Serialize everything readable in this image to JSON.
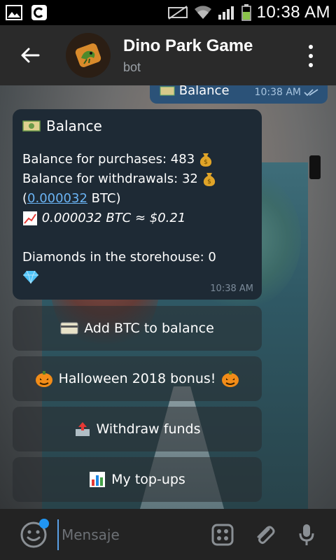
{
  "status_bar": {
    "time": "10:38 AM",
    "icons": [
      "image-icon",
      "c-app-icon",
      "nfc-muted-icon",
      "wifi-icon",
      "signal-icon",
      "battery-icon"
    ]
  },
  "header": {
    "title": "Dino Park Game",
    "subtitle": "bot"
  },
  "outgoing_message": {
    "text": "Balance",
    "time": "10:38 AM",
    "status": "read"
  },
  "incoming_message": {
    "title": "Balance",
    "purchases_label": "Balance for purchases:",
    "purchases_value": "483",
    "withdrawals_label": "Balance for withdrawals:",
    "withdrawals_value": "32",
    "btc_open": "(",
    "btc_link": "0.000032",
    "btc_close": " BTC)",
    "rate_text": "0.000032 BTC ≈ $0.21",
    "diamonds_label": "Diamonds in the storehouse:",
    "diamonds_value": "0",
    "time": "10:38 AM"
  },
  "keyboard_buttons": [
    {
      "label": "Add BTC to balance",
      "icon": "credit-card-icon"
    },
    {
      "label": "Halloween 2018 bonus!",
      "icon": "pumpkin-icon"
    },
    {
      "label": "Withdraw funds",
      "icon": "outbox-icon"
    },
    {
      "label": "My top-ups",
      "icon": "bar-chart-icon"
    }
  ],
  "input_bar": {
    "placeholder": "Mensaje"
  },
  "colors": {
    "header_bg": "#2a2a2a",
    "bubble_in": "#1e2a35",
    "bubble_out": "#2b5278",
    "link": "#6ab3f3",
    "accent": "#2196f3"
  }
}
